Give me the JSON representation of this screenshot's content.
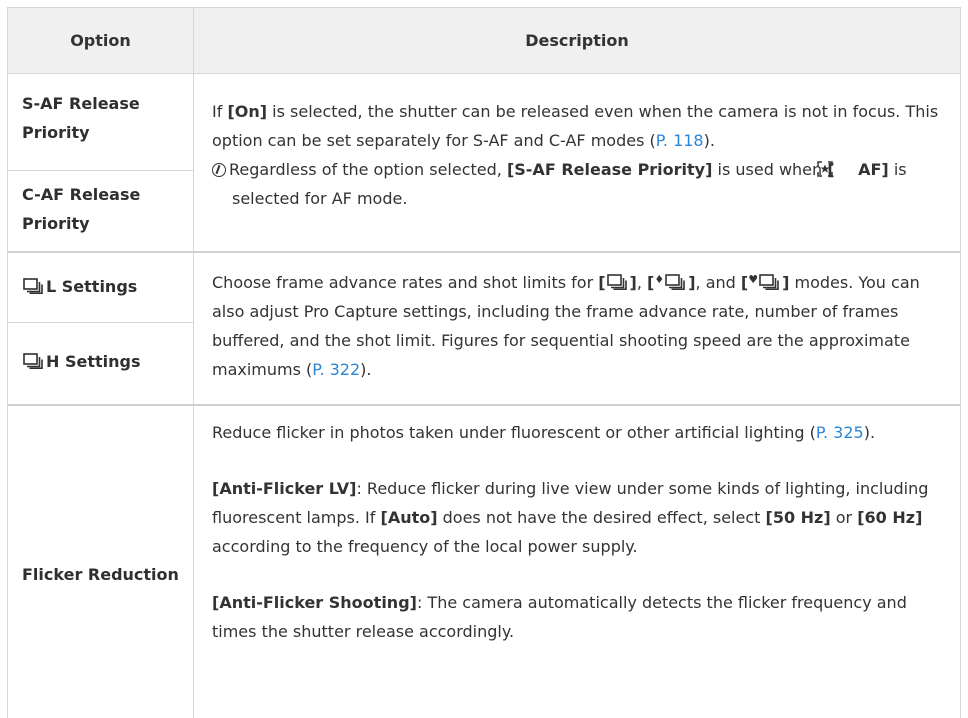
{
  "table": {
    "header": {
      "option": "Option",
      "description": "Description"
    },
    "rows": [
      {
        "options": [
          "S-AF Release Priority",
          "C-AF Release Priority"
        ],
        "desc": {
          "p1_part1": "If ",
          "p1_on": "[On]",
          "p1_part2": " is selected, the shutter can be released even when the camera is not in focus. This option can be set separately for S-AF and C-AF modes (",
          "p1_link": "P. 118",
          "p1_end": ").",
          "note_part1": "Regardless of the option selected, ",
          "note_bold1": "[S-AF Release Priority]",
          "note_part2": " is used when ",
          "note_bold2_open": "[",
          "note_bold2_close": " AF]",
          "note_part3": " is selected for AF mode."
        }
      },
      {
        "options": [
          "L Settings",
          "H Settings"
        ],
        "desc": {
          "part1": "Choose frame advance rates and shot limits for ",
          "b_open1": "[",
          "b_close1": "]",
          "sep1": ", ",
          "b_open2": "[",
          "mark2": "♦",
          "b_close2": "]",
          "sep2": ", and ",
          "b_open3": "[",
          "mark3": "♥",
          "b_close3": "]",
          "part2": " modes. You can also adjust Pro Capture settings, including the frame advance rate, number of frames buffered, and the shot limit. Figures for sequential shooting speed are the approximate maximums (",
          "link": "P. 322",
          "end": ")."
        }
      },
      {
        "options": [
          "Flicker Reduction"
        ],
        "desc": {
          "p1": "Reduce flicker in photos taken under fluorescent or other artificial lighting (",
          "p1_link": "P. 325",
          "p1_end": ").",
          "p2_bold": "[Anti-Flicker LV]",
          "p2_part1": ": Reduce flicker during live view under some kinds of lighting, including fluorescent lamps. If ",
          "p2_auto": "[Auto]",
          "p2_part2": " does not have the desired effect, select ",
          "p2_50": "[50 Hz]",
          "p2_or": " or ",
          "p2_60": "[60 Hz]",
          "p2_part3": " according to the frequency of the local power supply.",
          "p3_bold": "[Anti-Flicker Shooting]",
          "p3_part1": ": The camera automatically detects the flicker frequency and times the shutter release accordingly."
        }
      }
    ]
  },
  "colors": {
    "header_bg": "#f0f0f0",
    "border": "#d6d6d6",
    "link": "#2a86d8",
    "text": "#333333"
  },
  "icons": [
    "note-icon",
    "sequential-shooting-icon",
    "face-priority-af-icon"
  ]
}
